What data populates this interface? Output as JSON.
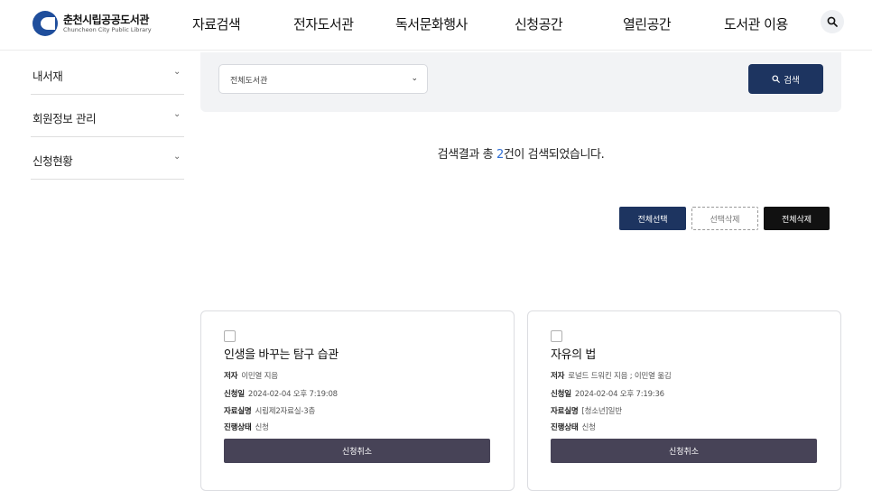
{
  "header": {
    "logo_title": "춘천시립공공도서관",
    "logo_subtitle": "Chuncheon City Public Library",
    "nav": [
      "자료검색",
      "전자도서관",
      "독서문화행사",
      "신청공간",
      "열린공간",
      "도서관 이용"
    ],
    "search_icon": "search-icon"
  },
  "sidebar": {
    "items": [
      {
        "label": "내서재"
      },
      {
        "label": "회원정보 관리"
      },
      {
        "label": "신청현황"
      }
    ]
  },
  "filter": {
    "library_select": "전체도서관",
    "search_button": "검색"
  },
  "result": {
    "prefix": "검색결과 총 ",
    "count": "2",
    "suffix": "건이 검색되었습니다."
  },
  "actions": {
    "select_all": "전체선택",
    "delete_selected": "선택삭제",
    "delete_all": "전체삭제"
  },
  "labels": {
    "author": "저자",
    "request_date": "신청일",
    "location": "자료실명",
    "status": "진행상태",
    "cancel": "신청취소"
  },
  "cards": [
    {
      "title": "인생을 바꾸는 탐구 습관",
      "author": "이민열 지음",
      "request_date": "2024-02-04 오후 7:19:08",
      "location": "시립제2자료실-3층",
      "status": "신청"
    },
    {
      "title": "자유의 법",
      "author": "로널드 드워킨 지음 ; 이민열 옮김",
      "request_date": "2024-02-04 오후 7:19:36",
      "location": "[청소년]일반",
      "status": "신청"
    }
  ]
}
